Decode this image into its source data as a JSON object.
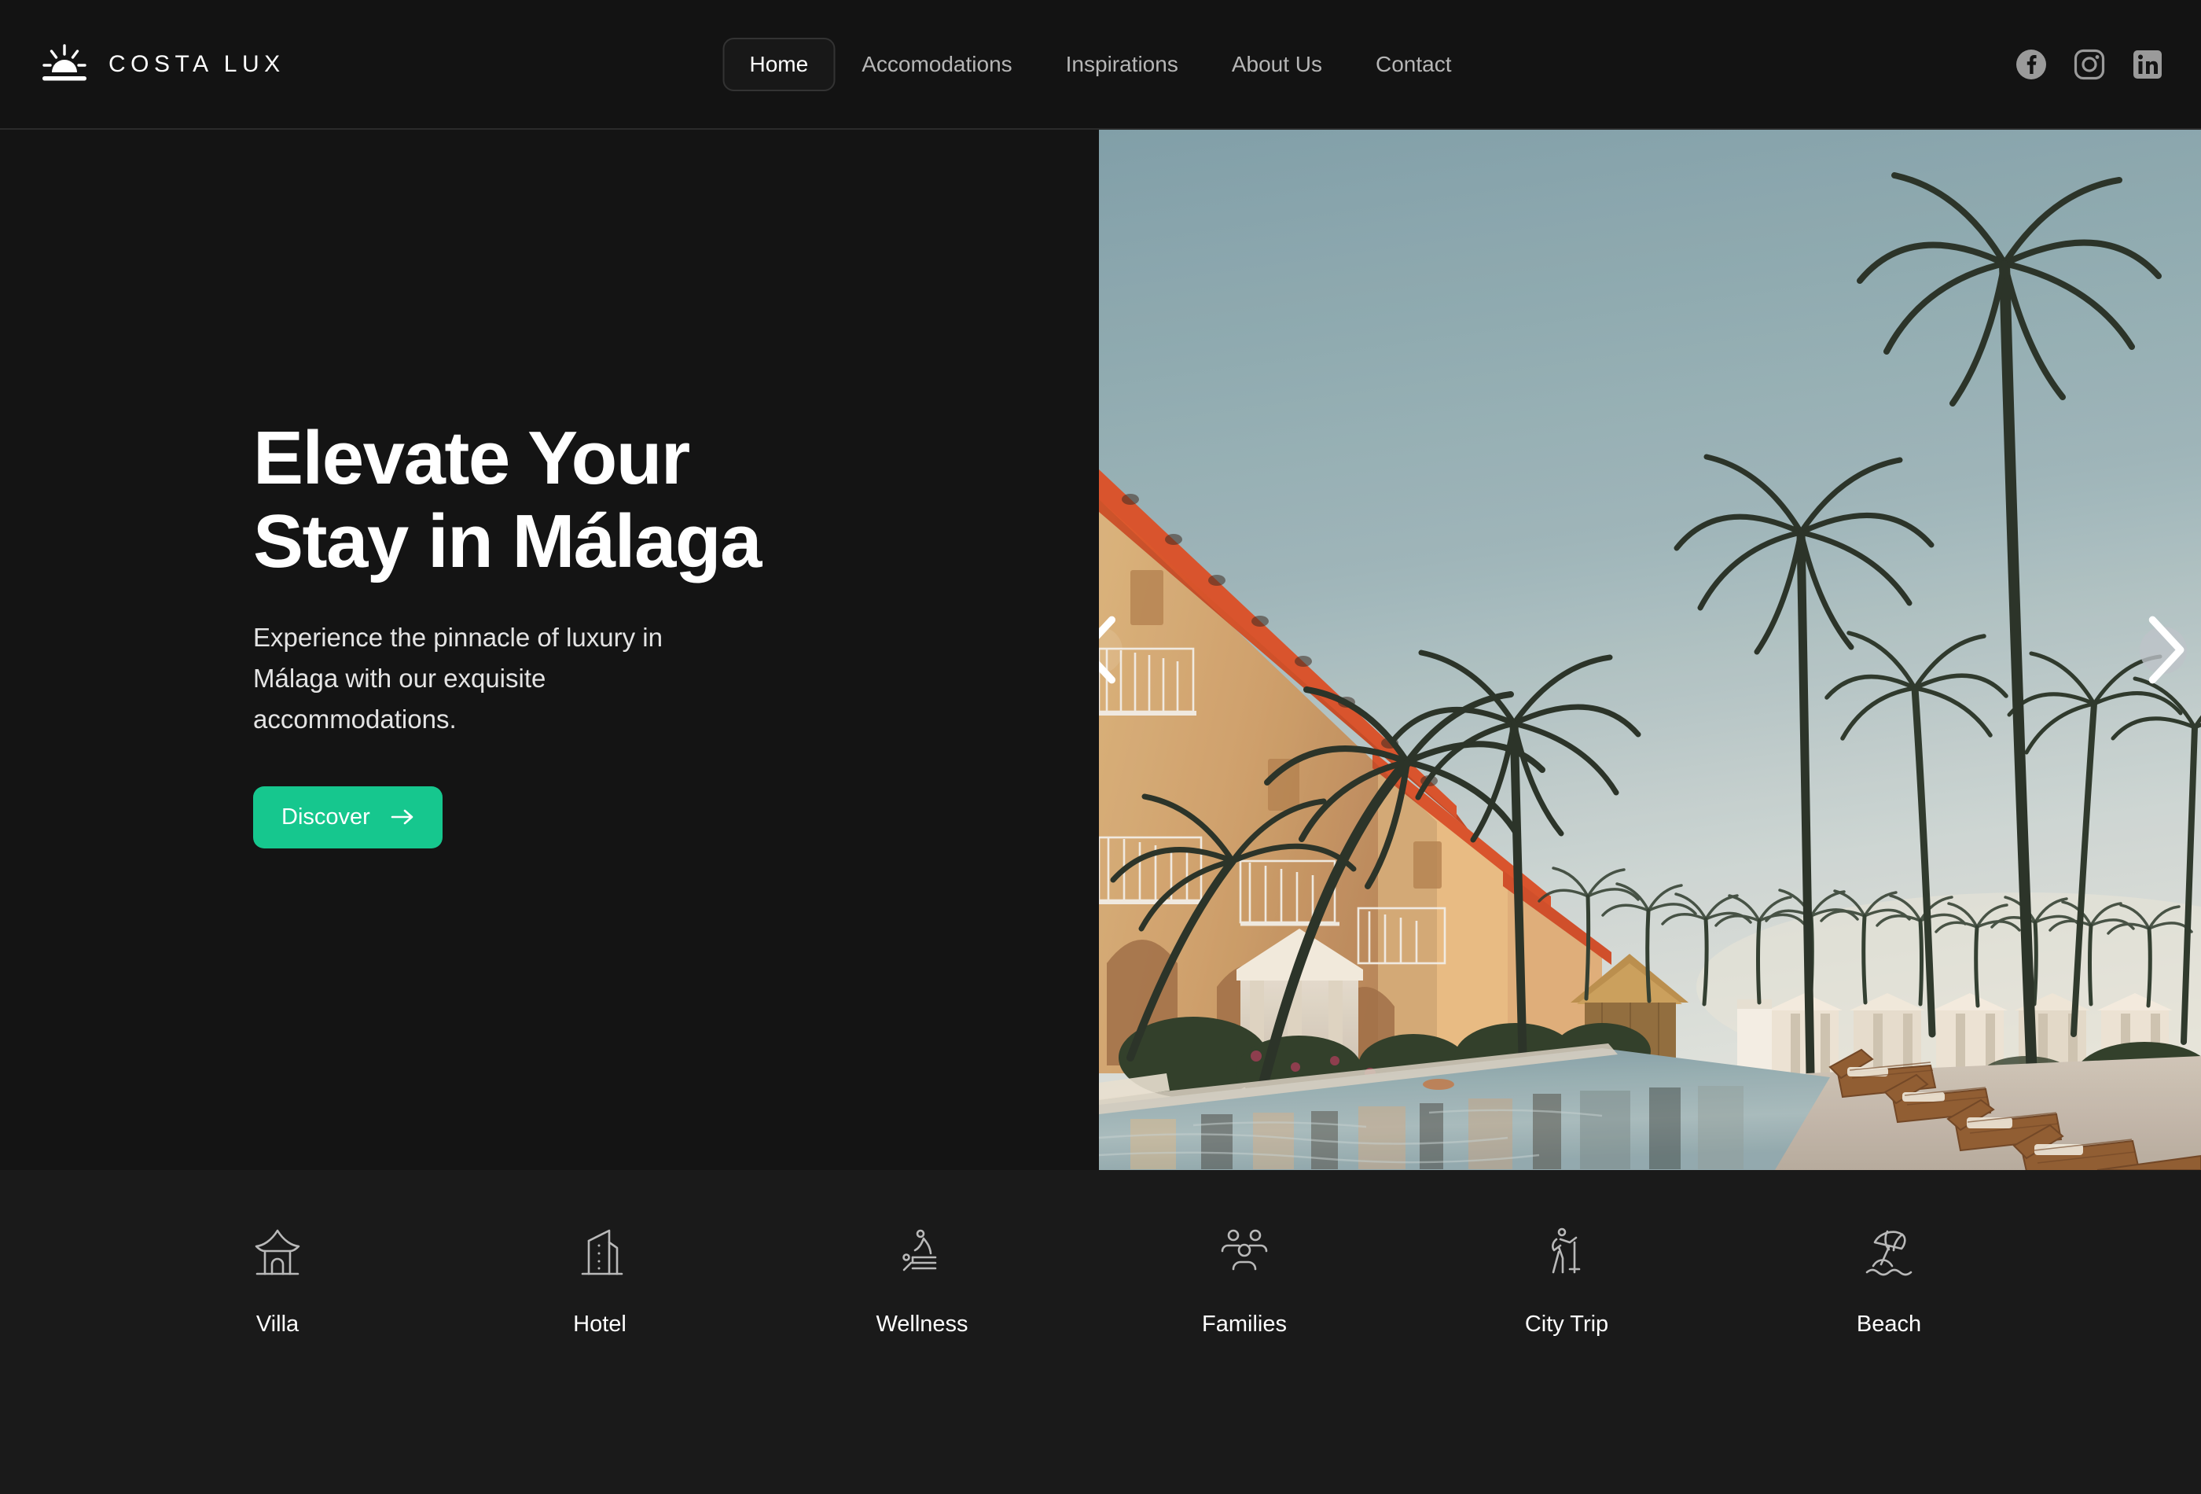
{
  "brand": {
    "name": "COSTA LUX",
    "logo_icon": "sunrise-icon"
  },
  "nav": {
    "items": [
      {
        "label": "Home",
        "active": true
      },
      {
        "label": "Accomodations",
        "active": false
      },
      {
        "label": "Inspirations",
        "active": false
      },
      {
        "label": "About Us",
        "active": false
      },
      {
        "label": "Contact",
        "active": false
      }
    ]
  },
  "socials": [
    {
      "name": "facebook-icon",
      "label": "Facebook"
    },
    {
      "name": "instagram-icon",
      "label": "Instagram"
    },
    {
      "name": "linkedin-icon",
      "label": "LinkedIn"
    }
  ],
  "hero": {
    "title": "Elevate Your\nStay in Málaga",
    "subtitle": "Experience the pinnacle of luxury in\nMálaga with our exquisite\naccommodations.",
    "cta_label": "Discover",
    "cta_icon": "arrow-right-icon",
    "prev_icon": "chevron-left-icon",
    "next_icon": "chevron-right-icon",
    "image_alt": "Resort pool lined with palm trees and sun loungers at golden hour"
  },
  "categories": [
    {
      "label": "Villa",
      "icon": "villa-icon"
    },
    {
      "label": "Hotel",
      "icon": "hotel-icon"
    },
    {
      "label": "Wellness",
      "icon": "wellness-icon"
    },
    {
      "label": "Families",
      "icon": "families-icon"
    },
    {
      "label": "City Trip",
      "icon": "city-trip-icon"
    },
    {
      "label": "Beach",
      "icon": "beach-icon"
    }
  ],
  "colors": {
    "background": "#141414",
    "header_background": "#131313",
    "categories_background": "#1a1a1a",
    "accent_green": "#16c78e",
    "text_primary": "#ffffff",
    "text_muted": "#b6b6b6",
    "border": "#333333"
  }
}
